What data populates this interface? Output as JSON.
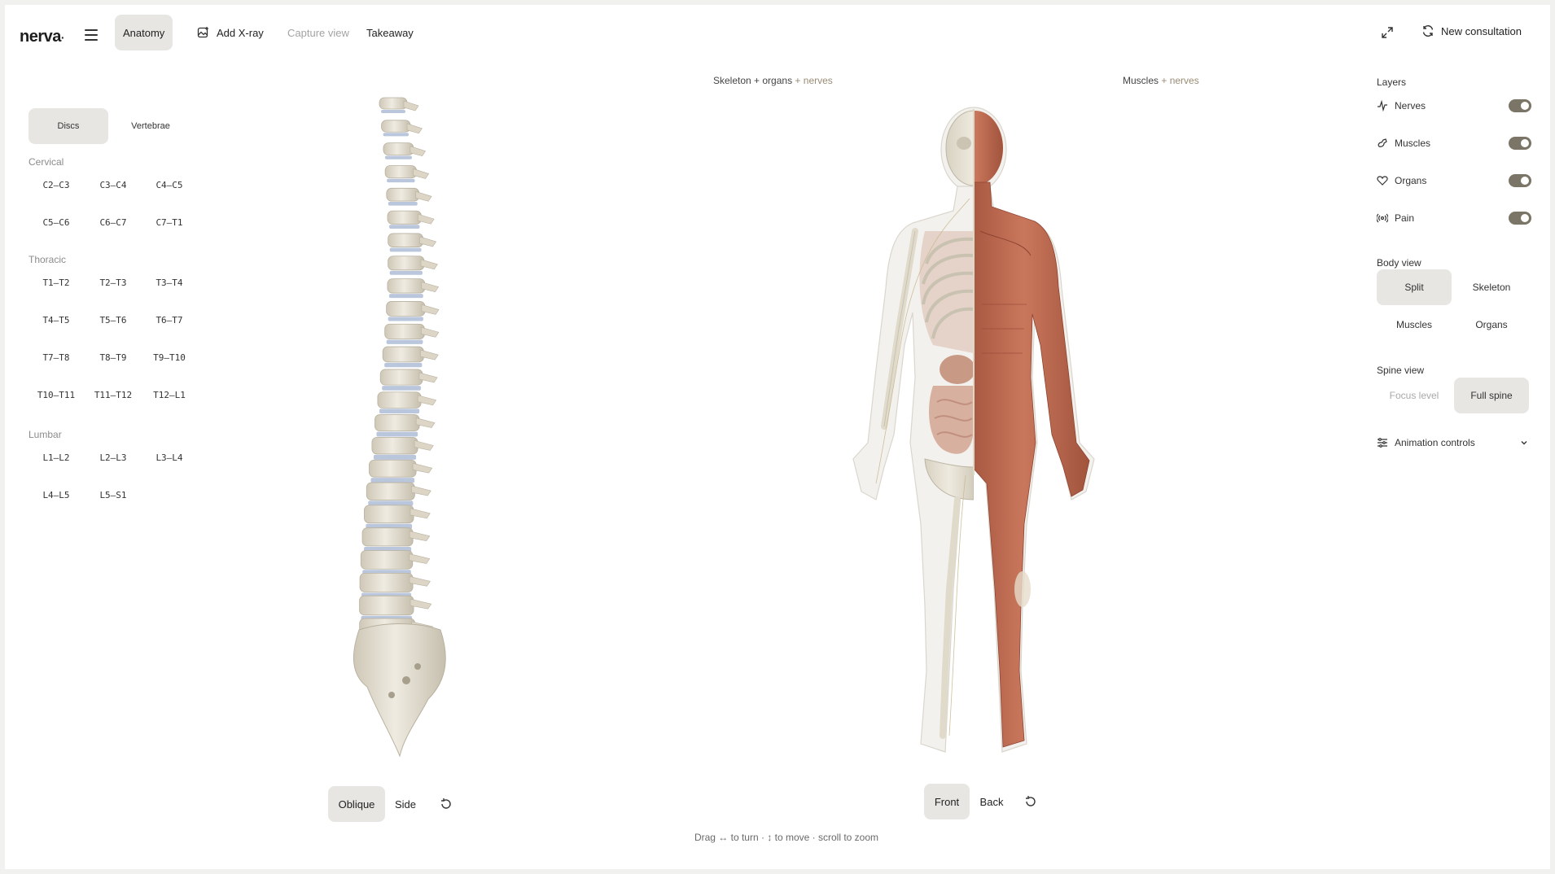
{
  "header": {
    "logo": "nerva",
    "nav": {
      "anatomy": "Anatomy",
      "add_xray": "Add X-ray",
      "capture_view": "Capture view",
      "takeaway": "Takeaway"
    },
    "new_consultation": "New consultation"
  },
  "left_panel": {
    "tabs": {
      "discs": "Discs",
      "vertebrae": "Vertebrae"
    },
    "groups": [
      {
        "label": "Cervical",
        "levels": [
          "C2–C3",
          "C3–C4",
          "C4–C5",
          "C5–C6",
          "C6–C7",
          "C7–T1"
        ]
      },
      {
        "label": "Thoracic",
        "levels": [
          "T1–T2",
          "T2–T3",
          "T3–T4",
          "T4–T5",
          "T5–T6",
          "T6–T7",
          "T7–T8",
          "T8–T9",
          "T9–T10",
          "T10–T11",
          "T11–T12",
          "T12–L1"
        ]
      },
      {
        "label": "Lumbar",
        "levels": [
          "L1–L2",
          "L2–L3",
          "L3–L4",
          "L4–L5",
          "L5–S1"
        ]
      }
    ]
  },
  "center": {
    "left_view_label": "Skeleton + organs",
    "left_view_accent": "+ nerves",
    "right_view_label": "Muscles",
    "right_view_accent": "+ nerves",
    "spine_controls": {
      "oblique": "Oblique",
      "side": "Side"
    },
    "body_controls": {
      "front": "Front",
      "back": "Back"
    },
    "hint": "Drag ↔ to turn · ↕ to move · scroll to zoom"
  },
  "right_panel": {
    "layers_title": "Layers",
    "layers": [
      {
        "label": "Nerves",
        "icon": "pulse-icon",
        "on": true
      },
      {
        "label": "Muscles",
        "icon": "muscle-icon",
        "on": true
      },
      {
        "label": "Organs",
        "icon": "heart-icon",
        "on": true
      },
      {
        "label": "Pain",
        "icon": "radiate-icon",
        "on": true
      }
    ],
    "body_view_title": "Body view",
    "body_view": {
      "split": "Split",
      "skeleton": "Skeleton",
      "muscles": "Muscles",
      "organs": "Organs",
      "selected": "Split"
    },
    "spine_view_title": "Spine view",
    "spine_view": {
      "focus_level": "Focus level",
      "full_spine": "Full spine",
      "selected": "Full spine"
    },
    "animation_controls": "Animation controls"
  },
  "colors": {
    "accent": "#9a8c75",
    "toggle_on": "#7a7566",
    "active_bg": "#e7e6e3",
    "bone": "#e6e0d2",
    "disc": "#b9c6dc",
    "muscle": "#b8674e"
  }
}
